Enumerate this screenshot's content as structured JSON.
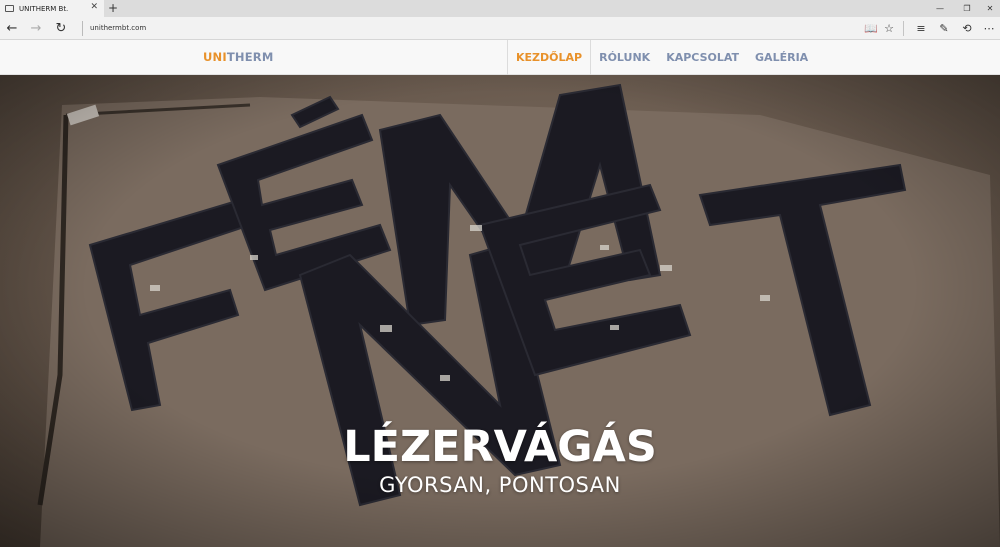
{
  "browser": {
    "tab_title": "UNITHERM Bt.",
    "new_tab_icon": "plus-icon",
    "address": "unithermbt.com"
  },
  "site": {
    "logo_part1": "UNI",
    "logo_part2": "THERM",
    "nav": [
      {
        "label": "KEZDŐLAP",
        "active": true
      },
      {
        "label": "RÓLUNK",
        "active": false
      },
      {
        "label": "KAPCSOLAT",
        "active": false
      },
      {
        "label": "GALÉRIA",
        "active": false
      }
    ],
    "colors": {
      "accent": "#e8912a",
      "nav_text": "#7f8fae"
    }
  },
  "hero": {
    "title": "LÉZERVÁGÁS",
    "subtitle": "GYORSAN, PONTOSAN"
  }
}
